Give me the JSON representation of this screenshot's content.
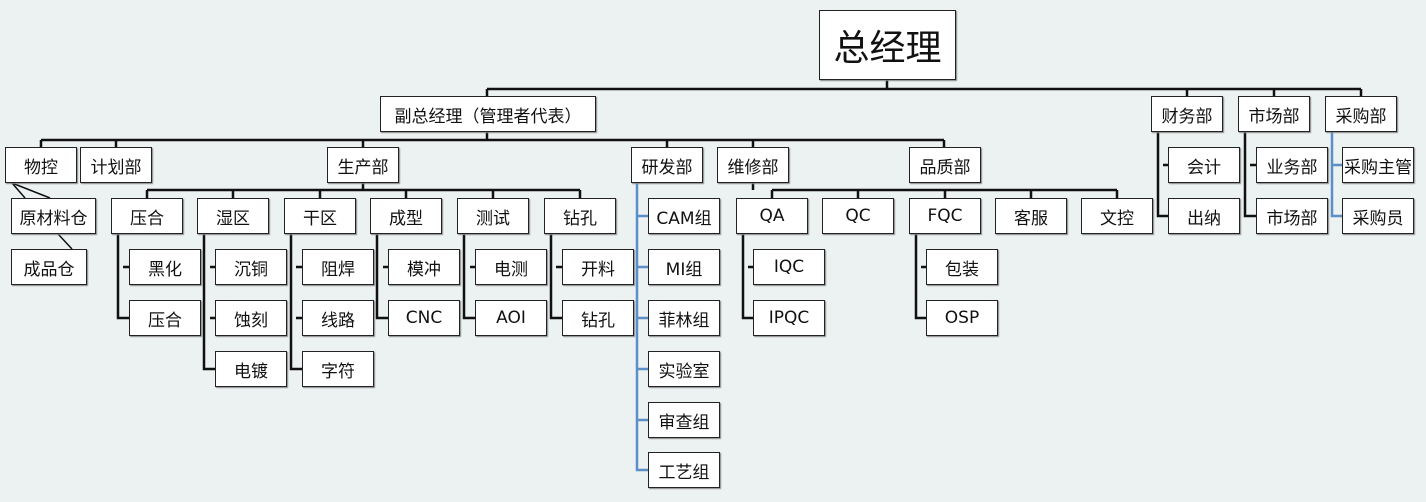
{
  "nodes": {
    "ceo": "总经理",
    "deputy": "副总经理（管理者代表）",
    "finance": "财务部",
    "market": "市场部",
    "purchase": "采购部",
    "wukong": "物控",
    "plan": "计划部",
    "production": "生产部",
    "rd": "研发部",
    "maint": "维修部",
    "quality": "品质部",
    "raw": "原材料仓",
    "finished": "成品仓",
    "yahe": "压合",
    "heihua": "黑化",
    "yahe2": "压合",
    "shiqu": "湿区",
    "chentong": "沉铜",
    "shike": "蚀刻",
    "diandu": "电镀",
    "ganqu": "干区",
    "zuhan": "阻焊",
    "xianlu": "线路",
    "zifu": "字符",
    "chengxing": "成型",
    "mochong": "模冲",
    "cnc": "CNC",
    "ceshi": "测试",
    "dianc": "电测",
    "aoi": "AOI",
    "zuankong": "钻孔",
    "kailiao": "开料",
    "zuankong2": "钻孔",
    "cam": "CAM组",
    "mi": "MI组",
    "feilin": "菲林组",
    "lab": "实验室",
    "review": "审查组",
    "process": "工艺组",
    "qa": "QA",
    "iqc": "IQC",
    "ipqc": "IPQC",
    "qc": "QC",
    "fqc": "FQC",
    "pack": "包装",
    "osp": "OSP",
    "service": "客服",
    "doc": "文控",
    "acct": "会计",
    "cashier": "出纳",
    "biz": "业务部",
    "market2": "市场部",
    "pmgr": "采购主管",
    "buyer": "采购员"
  },
  "colors": {
    "line": "#111111",
    "blue_line": "#5b8fc7",
    "background": "#ecf1f1"
  }
}
